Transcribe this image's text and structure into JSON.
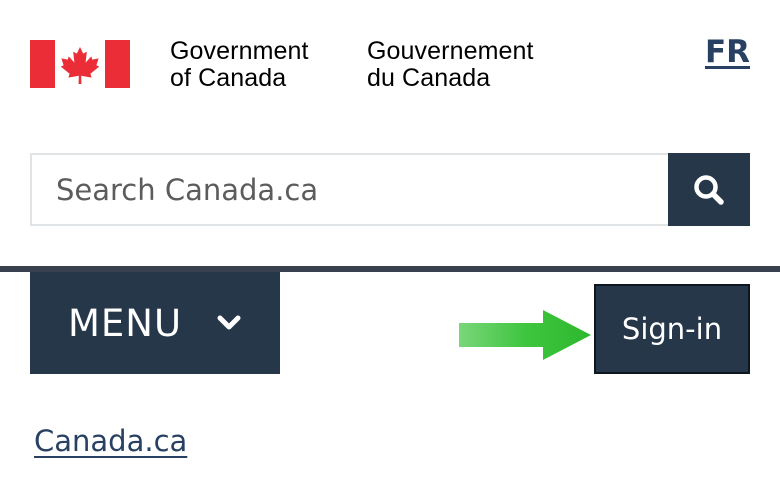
{
  "header": {
    "signature_en": [
      "Government",
      "of Canada"
    ],
    "signature_fr": [
      "Gouvernement",
      "du Canada"
    ],
    "language_toggle": "FR",
    "colors": {
      "flag_red": "#eb2d37",
      "navy": "#26374a",
      "link": "#284162",
      "arrow_green": "#3dc33d"
    }
  },
  "search": {
    "placeholder": "Search Canada.ca",
    "button_icon": "search-icon"
  },
  "nav": {
    "menu_label": "MENU",
    "menu_icon": "chevron-down-icon",
    "signin_label": "Sign-in",
    "annotation_icon": "arrow-right-icon"
  },
  "breadcrumb": {
    "home_label": "Canada.ca"
  }
}
